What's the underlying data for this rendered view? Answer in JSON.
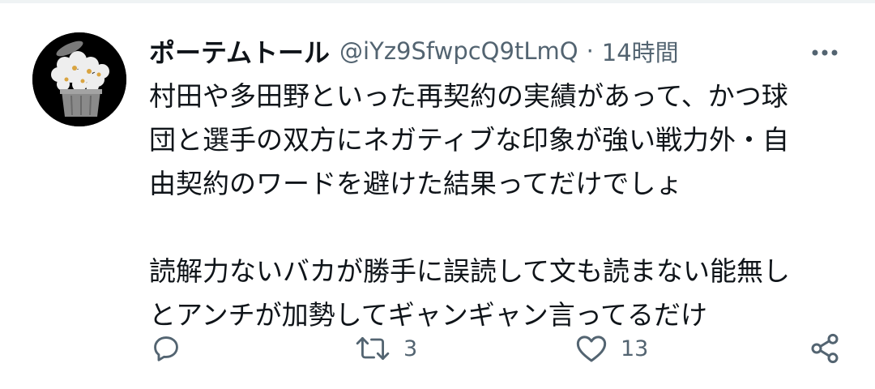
{
  "tweet": {
    "display_name": "ポーテムトール",
    "handle": "@iYz9SfwpcQ9tLmQ",
    "separator": "·",
    "time": "14時間",
    "paragraphs": [
      "村田や多田野といった再契約の実績があって、かつ球\n団と選手の双方にネガティブな印象が強い戦力外・自\n由契約のワードを避けた結果ってだけでしょ",
      "読解力ないバカが勝手に誤読して文も読まない能無し\nとアンチが加勢してギャンギャン言ってるだけ"
    ]
  },
  "actions": {
    "reply": {
      "icon": "reply-icon",
      "count": ""
    },
    "retweet": {
      "icon": "retweet-icon",
      "count": "3"
    },
    "like": {
      "icon": "heart-icon",
      "count": "13"
    },
    "share": {
      "icon": "share-icon"
    }
  },
  "colors": {
    "text_primary": "#0f1419",
    "text_secondary": "#536471",
    "avatar_bg": "#000000"
  }
}
